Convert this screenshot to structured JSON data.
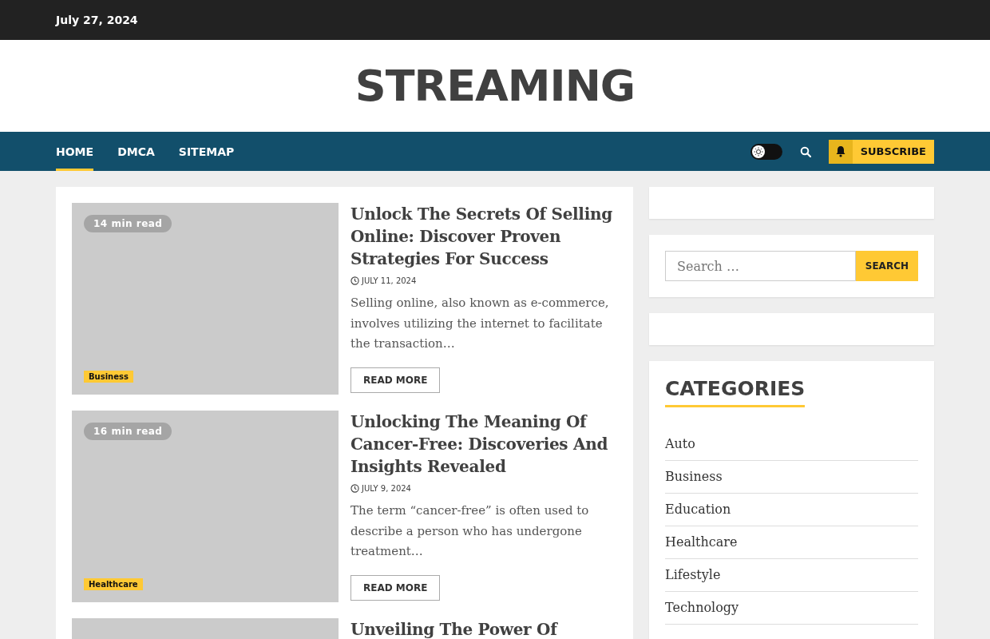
{
  "top_bar": {
    "date": "July 27, 2024"
  },
  "site_title": "STREAMING",
  "nav": {
    "items": [
      {
        "label": "HOME",
        "selected": true
      },
      {
        "label": "DMCA",
        "selected": false
      },
      {
        "label": "SITEMAP",
        "selected": false
      }
    ],
    "dark_mode": false,
    "subscribe": "SUBSCRIBE"
  },
  "articles": [
    {
      "read_time": "14 min read",
      "category": "Business",
      "title": "Unlock The Secrets Of Selling Online: Discover Proven Strategies For Success",
      "date": "JULY 11, 2024",
      "excerpt": "Selling online, also known as e-commerce, involves utilizing the internet to facilitate the transaction…",
      "button": "READ MORE"
    },
    {
      "read_time": "16 min read",
      "category": "Healthcare",
      "title": "Unlocking The Meaning Of Cancer-Free: Discoveries And Insights Revealed",
      "date": "JULY 9, 2024",
      "excerpt": "The term “cancer-free” is often used to describe a person who has undergone treatment…",
      "button": "READ MORE"
    },
    {
      "title": "Unveiling The Power Of"
    }
  ],
  "sidebar": {
    "search": {
      "placeholder": "Search …",
      "button": "SEARCH"
    },
    "categories": {
      "title": "CATEGORIES",
      "items": [
        "Auto",
        "Business",
        "Education",
        "Healthcare",
        "Lifestyle",
        "Technology"
      ]
    }
  }
}
